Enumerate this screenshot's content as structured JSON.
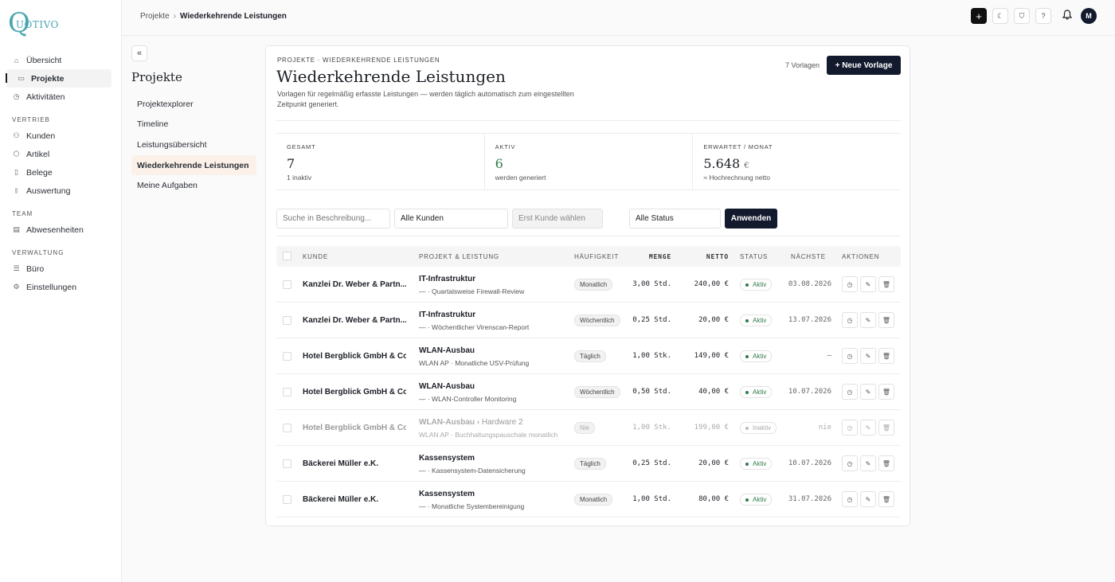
{
  "brand": {
    "logo_mark": "Q",
    "logo_text": "UOTIVO",
    "color": "#4aa6b0"
  },
  "sidebar": {
    "items": [
      {
        "label": "Übersicht",
        "icon": "home-icon",
        "glyph": "⌂"
      },
      {
        "label": "Projekte",
        "icon": "folder-icon",
        "glyph": "▭"
      },
      {
        "label": "Aktivitäten",
        "icon": "clock-icon",
        "glyph": "◷"
      }
    ],
    "sections": [
      {
        "title": "VERTRIEB",
        "items": [
          {
            "label": "Kunden",
            "icon": "users-icon",
            "glyph": "⚇"
          },
          {
            "label": "Artikel",
            "icon": "box-icon",
            "glyph": "⬡"
          },
          {
            "label": "Belege",
            "icon": "document-icon",
            "glyph": "▯"
          },
          {
            "label": "Auswertung",
            "icon": "bar-chart-icon",
            "glyph": "⫾"
          }
        ]
      },
      {
        "title": "TEAM",
        "items": [
          {
            "label": "Abwesenheiten",
            "icon": "calendar-icon",
            "glyph": "▤"
          }
        ]
      },
      {
        "title": "VERWALTUNG",
        "items": [
          {
            "label": "Büro",
            "icon": "office-icon",
            "glyph": "☰"
          },
          {
            "label": "Einstellungen",
            "icon": "gear-icon",
            "glyph": "⚙"
          }
        ]
      }
    ]
  },
  "topbar": {
    "breadcrumb": [
      "Projekte",
      "Wiederkehrende Leistungen"
    ],
    "sep": "›",
    "plus": "+",
    "moon": "☾",
    "shield": "⛉",
    "help": "?",
    "bell": "🔔",
    "avatar": "M"
  },
  "subnav": {
    "collapse": "«",
    "title": "Projekte",
    "items": [
      "Projektexplorer",
      "Timeline",
      "Leistungsübersicht",
      "Wiederkehrende Leistungen",
      "Meine Aufgaben"
    ]
  },
  "page": {
    "eyebrow": "PROJEKTE · WIEDERKEHRENDE LEISTUNGEN",
    "title": "Wiederkehrende Leistungen",
    "description": "Vorlagen für regelmäßig erfasste Leistungen — werden täglich automatisch zum eingestellten Zeitpunkt generiert.",
    "count": "7 Vorlagen",
    "new_button": "+  Neue Vorlage"
  },
  "stats": [
    {
      "label": "GESAMT",
      "value": "7",
      "unit": "",
      "sub": "1 inaktiv"
    },
    {
      "label": "AKTIV",
      "value": "6",
      "unit": "",
      "sub": "werden generiert"
    },
    {
      "label": "ERWARTET / MONAT",
      "value": "5.648",
      "unit": "€",
      "sub": "≈ Hochrechnung netto"
    }
  ],
  "filters": {
    "search_placeholder": "Suche in Beschreibung...",
    "kunden": "Alle Kunden",
    "kunde_first": "Erst Kunde wählen",
    "status": "Alle Status",
    "apply": "Anwenden"
  },
  "table": {
    "headers": {
      "kunde": "KUNDE",
      "projekt": "PROJEKT & LEISTUNG",
      "freq": "HÄUFIGKEIT",
      "menge": "MENGE",
      "netto": "NETTO",
      "status": "STATUS",
      "naechste": "NÄCHSTE",
      "aktionen": "AKTIONEN"
    },
    "rows": [
      {
        "kunde": "Kanzlei Dr. Weber & Partn...",
        "projekt": "IT-Infrastruktur",
        "extra": "",
        "leistung": "— · Quartalsweise Firewall-Review",
        "freq": "Monatlich",
        "menge": "3,00 Std.",
        "netto": "240,00 €",
        "status": "Aktiv",
        "naechste": "03.08.2026",
        "inactive": false
      },
      {
        "kunde": "Kanzlei Dr. Weber & Partn...",
        "projekt": "IT-Infrastruktur",
        "extra": "",
        "leistung": "— · Wöchentlicher Virenscan-Report",
        "freq": "Wöchentlich",
        "menge": "0,25 Std.",
        "netto": "20,00 €",
        "status": "Aktiv",
        "naechste": "13.07.2026",
        "inactive": false
      },
      {
        "kunde": "Hotel Bergblick GmbH & Co...",
        "projekt": "WLAN-Ausbau",
        "extra": "",
        "leistung": "WLAN AP · Monatliche USV-Prüfung",
        "freq": "Täglich",
        "menge": "1,00 Stk.",
        "netto": "149,00 €",
        "status": "Aktiv",
        "naechste": "–",
        "inactive": false
      },
      {
        "kunde": "Hotel Bergblick GmbH & Co...",
        "projekt": "WLAN-Ausbau",
        "extra": "",
        "leistung": "— · WLAN-Controller Monitoring",
        "freq": "Wöchentlich",
        "menge": "0,50 Std.",
        "netto": "40,00 €",
        "status": "Aktiv",
        "naechste": "10.07.2026",
        "inactive": false
      },
      {
        "kunde": "Hotel Bergblick GmbH & Co...",
        "projekt": "WLAN-Ausbau",
        "extra": " › Hardware 2",
        "leistung": "WLAN AP · Buchhaltungspauschale monatlich",
        "freq": "Nie",
        "menge": "1,00 Stk.",
        "netto": "199,00 €",
        "status": "Inaktiv",
        "naechste": "nie",
        "inactive": true
      },
      {
        "kunde": "Bäckerei Müller e.K.",
        "projekt": "Kassensystem",
        "extra": "",
        "leistung": "— · Kassensystem-Datensicherung",
        "freq": "Täglich",
        "menge": "0,25 Std.",
        "netto": "20,00 €",
        "status": "Aktiv",
        "naechste": "10.07.2026",
        "inactive": false
      },
      {
        "kunde": "Bäckerei Müller e.K.",
        "projekt": "Kassensystem",
        "extra": "",
        "leistung": "— · Monatliche Systembereinigung",
        "freq": "Monatlich",
        "menge": "1,00 Std.",
        "netto": "80,00 €",
        "status": "Aktiv",
        "naechste": "31.07.2026",
        "inactive": false
      }
    ],
    "action_icons": {
      "history": "◷",
      "edit": "✎",
      "delete": "🗑"
    }
  }
}
